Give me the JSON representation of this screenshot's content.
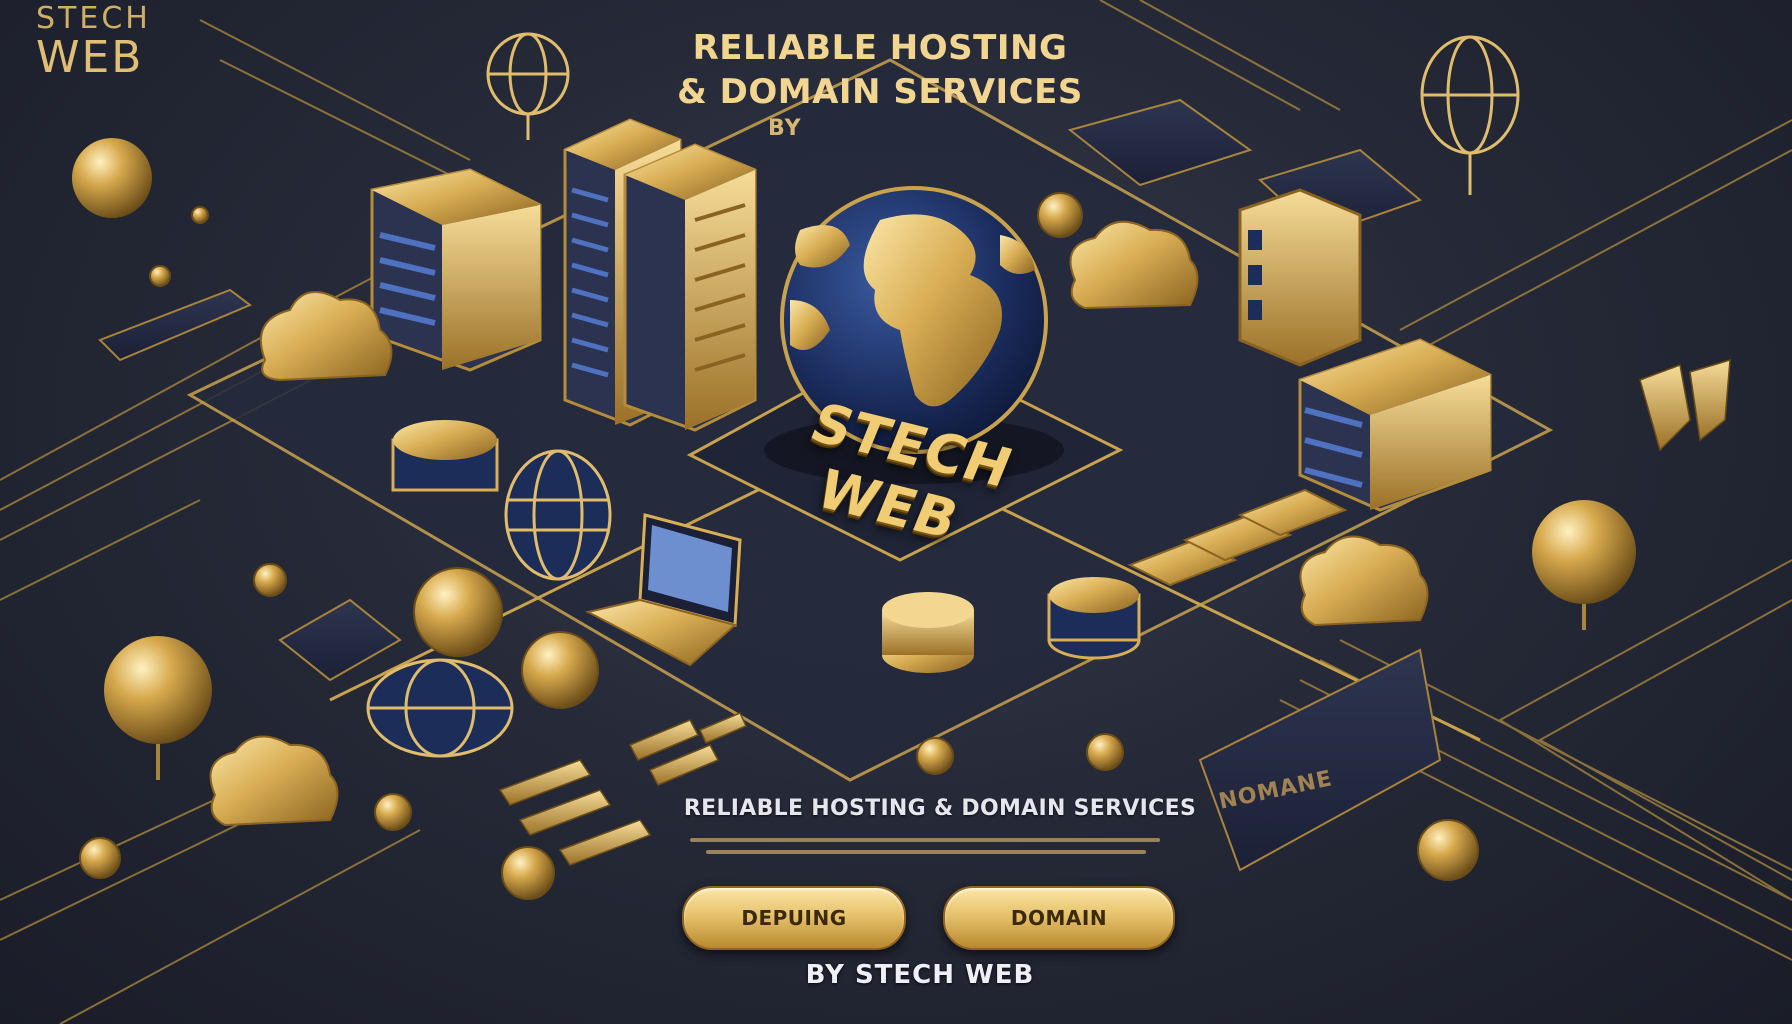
{
  "brand": {
    "line1": "STECH",
    "line2": "WEB"
  },
  "header": {
    "headline_line1": "RELIABLE HOSTING",
    "headline_line2": "& DOMAIN SERVICES",
    "byline": "BY"
  },
  "center": {
    "brand": "STECH WEB"
  },
  "footer": {
    "tagline": "RELIABLE HOSTING & DOMAIN SERVICES",
    "left_button_label": "DEPUING",
    "right_button_label": "DOMAIN",
    "byline": "BY STECH WEB"
  },
  "decor": {
    "panel_text": "NOMANE"
  },
  "icons": [
    "globe-icon",
    "server-icon",
    "cloud-icon",
    "laptop-icon",
    "database-icon",
    "gear-icon"
  ],
  "colors": {
    "gold": "#e7c26c",
    "navy": "#1c2d5a",
    "background": "#262a38"
  }
}
